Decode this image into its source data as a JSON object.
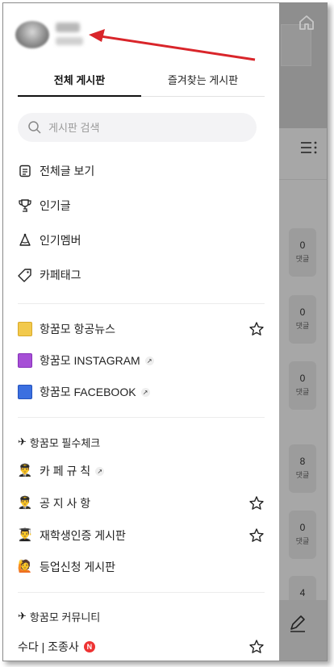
{
  "tabs": {
    "all": "전체 게시판",
    "favorites": "즐겨찾는 게시판"
  },
  "search": {
    "placeholder": "게시판 검색"
  },
  "menu": [
    {
      "label": "전체글 보기",
      "icon": "document-icon"
    },
    {
      "label": "인기글",
      "icon": "trophy-icon"
    },
    {
      "label": "인기멤버",
      "icon": "party-hat-icon"
    },
    {
      "label": "카페태그",
      "icon": "tag-icon"
    }
  ],
  "boards": [
    {
      "label": "항꿈모 항공뉴스",
      "color": "#f2c94c",
      "star": true
    },
    {
      "label": "항꿈모 INSTAGRAM",
      "color": "#a64fd6",
      "external": true
    },
    {
      "label": "항꿈모 FACEBOOK",
      "color": "#3b6fe0",
      "external": true
    }
  ],
  "section1": {
    "title": "항꿈모 필수체크",
    "items": [
      {
        "label": "카 페 규 칙",
        "icon": "pilot-icon",
        "external": true
      },
      {
        "label": "공 지 사 항",
        "icon": "pilot-icon",
        "star": true
      },
      {
        "label": "재학생인증 게시판",
        "icon": "student-icon",
        "star": true
      },
      {
        "label": "등업신청 게시판",
        "icon": "raising-hand-icon"
      }
    ]
  },
  "section2": {
    "title": "항꿈모 커뮤니티",
    "items": [
      {
        "label": "수다 | 조종사",
        "badge": "N",
        "star": true
      }
    ]
  },
  "background": {
    "comment_label": "댓글",
    "counts": [
      "0",
      "0",
      "0",
      "8",
      "0",
      "4"
    ]
  },
  "colors": {
    "accent": "#111111",
    "annotation_arrow": "#d9252a"
  }
}
